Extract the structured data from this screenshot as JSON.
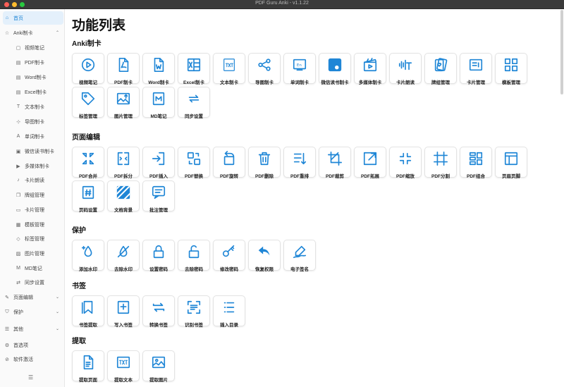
{
  "window": {
    "title": "PDF Guru Anki - v1.1.22",
    "accent": "#1f86d6"
  },
  "sidebar": {
    "items": [
      {
        "label": "首页",
        "icon": "home-icon",
        "glyph": "⌂",
        "level": 0,
        "active": true,
        "chev": ""
      },
      {
        "label": "Anki制卡",
        "icon": "star-icon",
        "glyph": "☆",
        "level": 0,
        "active": false,
        "chev": "⌃"
      },
      {
        "label": "视频笔记",
        "icon": "video-icon",
        "glyph": "▢",
        "level": 1
      },
      {
        "label": "PDF制卡",
        "icon": "pdf-icon",
        "glyph": "▤",
        "level": 1
      },
      {
        "label": "Word制卡",
        "icon": "word-icon",
        "glyph": "▤",
        "level": 1
      },
      {
        "label": "Excel制卡",
        "icon": "excel-icon",
        "glyph": "▤",
        "level": 1
      },
      {
        "label": "文本制卡",
        "icon": "text-icon",
        "glyph": "T",
        "level": 1
      },
      {
        "label": "导图制卡",
        "icon": "mindmap-icon",
        "glyph": "⊹",
        "level": 1
      },
      {
        "label": "单词制卡",
        "icon": "word-card-icon",
        "glyph": "A",
        "level": 1
      },
      {
        "label": "微信读书制卡",
        "icon": "wechat-read-icon",
        "glyph": "▣",
        "level": 1
      },
      {
        "label": "多媒体制卡",
        "icon": "media-icon",
        "glyph": "▶",
        "level": 1
      },
      {
        "label": "卡片朗读",
        "icon": "read-aloud-icon",
        "glyph": "♪",
        "level": 1
      },
      {
        "label": "牌组管理",
        "icon": "deck-icon",
        "glyph": "❐",
        "level": 1
      },
      {
        "label": "卡片管理",
        "icon": "card-icon",
        "glyph": "▭",
        "level": 1
      },
      {
        "label": "模板管理",
        "icon": "template-icon",
        "glyph": "▦",
        "level": 1
      },
      {
        "label": "标签管理",
        "icon": "tag-icon",
        "glyph": "◇",
        "level": 1
      },
      {
        "label": "图片管理",
        "icon": "image-icon",
        "glyph": "▨",
        "level": 1
      },
      {
        "label": "MD笔记",
        "icon": "markdown-icon",
        "glyph": "M",
        "level": 1
      },
      {
        "label": "同步设置",
        "icon": "sync-icon",
        "glyph": "⇄",
        "level": 1
      },
      {
        "label": "页面编辑",
        "icon": "edit-icon",
        "glyph": "✎",
        "level": 0,
        "chev": "⌄"
      },
      {
        "label": "保护",
        "icon": "shield-icon",
        "glyph": "⛉",
        "level": 0,
        "chev": "⌄"
      },
      {
        "label": "其他",
        "icon": "other-icon",
        "glyph": "☰",
        "level": 0,
        "chev": "⌄"
      },
      {
        "label": "首选项",
        "icon": "gear-icon",
        "glyph": "⚙",
        "level": 0
      },
      {
        "label": "软件激活",
        "icon": "activate-icon",
        "glyph": "⊘",
        "level": 0
      }
    ],
    "collapse_icon": "☰"
  },
  "main": {
    "title": "功能列表",
    "sections": [
      {
        "title": "Anki制卡",
        "items": [
          {
            "label": "视频笔记",
            "icon": "play-circle-icon"
          },
          {
            "label": "PDF制卡",
            "icon": "pdf-file-icon"
          },
          {
            "label": "Word制卡",
            "icon": "word-file-icon"
          },
          {
            "label": "Excel制卡",
            "icon": "excel-file-icon"
          },
          {
            "label": "文本制卡",
            "icon": "txt-file-icon"
          },
          {
            "label": "导图制卡",
            "icon": "share-nodes-icon"
          },
          {
            "label": "单词制卡",
            "icon": "en-card-icon"
          },
          {
            "label": "微信读书制卡",
            "icon": "wechat-book-icon"
          },
          {
            "label": "多媒体制卡",
            "icon": "clapper-icon"
          },
          {
            "label": "卡片朗读",
            "icon": "voice-text-icon"
          },
          {
            "label": "牌组管理",
            "icon": "cards-stack-icon"
          },
          {
            "label": "卡片管理",
            "icon": "card-list-icon"
          },
          {
            "label": "模板管理",
            "icon": "template-grid-icon"
          },
          {
            "label": "标签管理",
            "icon": "tag-icon"
          },
          {
            "label": "图片管理",
            "icon": "image-upload-icon"
          },
          {
            "label": "MD笔记",
            "icon": "md-file-icon"
          },
          {
            "label": "同步设置",
            "icon": "sync-cloud-icon"
          }
        ]
      },
      {
        "title": "页面编辑",
        "items": [
          {
            "label": "PDF合并",
            "icon": "merge-icon"
          },
          {
            "label": "PDF拆分",
            "icon": "split-icon"
          },
          {
            "label": "PDF插入",
            "icon": "insert-icon"
          },
          {
            "label": "PDF替换",
            "icon": "replace-icon"
          },
          {
            "label": "PDF旋转",
            "icon": "rotate-icon"
          },
          {
            "label": "PDF删除",
            "icon": "trash-icon"
          },
          {
            "label": "PDF重排",
            "icon": "reorder-icon"
          },
          {
            "label": "PDF裁剪",
            "icon": "crop-icon"
          },
          {
            "label": "PDF拓展",
            "icon": "expand-icon"
          },
          {
            "label": "PDF缩放",
            "icon": "shrink-icon"
          },
          {
            "label": "PDF分割",
            "icon": "cut-grid-icon"
          },
          {
            "label": "PDF组合",
            "icon": "combine-icon"
          },
          {
            "label": "页眉页脚",
            "icon": "header-footer-icon"
          },
          {
            "label": "页码设置",
            "icon": "page-number-icon"
          },
          {
            "label": "文档背景",
            "icon": "background-icon"
          },
          {
            "label": "批注管理",
            "icon": "comment-icon"
          }
        ]
      },
      {
        "title": "保护",
        "items": [
          {
            "label": "添加水印",
            "icon": "watermark-add-icon"
          },
          {
            "label": "去除水印",
            "icon": "watermark-remove-icon"
          },
          {
            "label": "设置密码",
            "icon": "lock-icon"
          },
          {
            "label": "去除密码",
            "icon": "unlock-icon"
          },
          {
            "label": "修改密码",
            "icon": "key-icon"
          },
          {
            "label": "恢复权限",
            "icon": "undo-arrow-icon"
          },
          {
            "label": "电子签名",
            "icon": "signature-icon"
          }
        ]
      },
      {
        "title": "书签",
        "items": [
          {
            "label": "书签提取",
            "icon": "bookmark-icon"
          },
          {
            "label": "写入书签",
            "icon": "bookmark-add-icon"
          },
          {
            "label": "转换书签",
            "icon": "convert-icon"
          },
          {
            "label": "识别书签",
            "icon": "scan-icon"
          },
          {
            "label": "插入目录",
            "icon": "toc-icon"
          }
        ]
      },
      {
        "title": "提取",
        "items": [
          {
            "label": "提取页面",
            "icon": "extract-page-icon"
          },
          {
            "label": "提取文本",
            "icon": "extract-text-icon"
          },
          {
            "label": "提取图片",
            "icon": "extract-image-icon"
          }
        ]
      }
    ]
  }
}
